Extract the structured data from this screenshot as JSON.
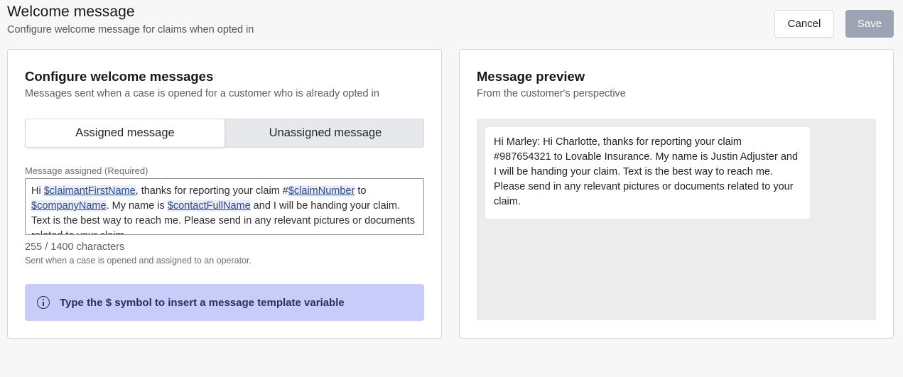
{
  "header": {
    "title": "Welcome message",
    "subtitle": "Configure welcome message for claims when opted in",
    "cancel_label": "Cancel",
    "save_label": "Save"
  },
  "configure": {
    "title": "Configure welcome messages",
    "subtitle": "Messages sent when a case is opened for a customer who is already opted in",
    "tabs": [
      {
        "label": "Assigned message",
        "selected": true
      },
      {
        "label": "Unassigned message",
        "selected": false
      }
    ],
    "field_label": "Message assigned (Required)",
    "message": {
      "t1": "Hi ",
      "v1": "$claimantFirstName",
      "t2": ", thanks for reporting your claim #",
      "v2": "$claimNumber",
      "t3": " to ",
      "v3": "$companyName",
      "t4": ".   My name is ",
      "v4": "$contactFullName",
      "t5": " and I will be handing your claim.  Text is the best way to reach me.  Please send in any relevant pictures or documents related to your claim."
    },
    "char_count": "255 / 1400 characters",
    "help_text": "Sent when a case is opened and assigned to an operator.",
    "info_text": "Type the $ symbol to insert a message template variable"
  },
  "preview": {
    "title": "Message preview",
    "subtitle": "From the customer's perspective",
    "message": "Hi Marley: Hi Charlotte, thanks for reporting your claim #987654321 to Lovable Insurance.   My name is Justin Adjuster and I will be handing your claim.  Text is the best way to reach me.  Please send in any relevant pictures or documents related to your claim."
  },
  "colors": {
    "save_disabled": "#9ea3b4",
    "info_banner": "#c7cdf8",
    "variable_link": "#2c4a8c"
  },
  "icons": {
    "info": "info-icon"
  }
}
